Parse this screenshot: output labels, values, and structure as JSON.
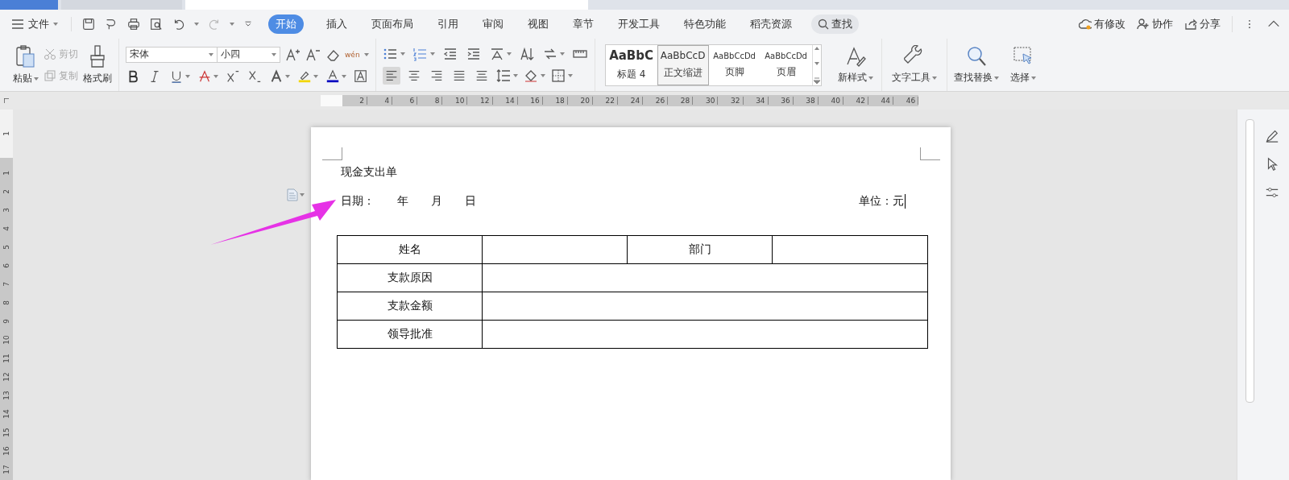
{
  "window_tabs": [
    {
      "kind": "home",
      "selected": false
    },
    {
      "kind": "template",
      "selected": false
    },
    {
      "kind": "document",
      "selected": true
    }
  ],
  "menu": {
    "file_label": "文件",
    "tabs": [
      {
        "label": "开始",
        "selected": true
      },
      {
        "label": "插入",
        "selected": false
      },
      {
        "label": "页面布局",
        "selected": false
      },
      {
        "label": "引用",
        "selected": false
      },
      {
        "label": "审阅",
        "selected": false
      },
      {
        "label": "视图",
        "selected": false
      },
      {
        "label": "章节",
        "selected": false
      },
      {
        "label": "开发工具",
        "selected": false
      },
      {
        "label": "特色功能",
        "selected": false
      },
      {
        "label": "稻壳资源",
        "selected": false
      }
    ],
    "search_label": "查找",
    "actions": [
      {
        "kind": "modified",
        "label": "有修改"
      },
      {
        "kind": "collaborate",
        "label": "协作"
      },
      {
        "kind": "share",
        "label": "分享"
      }
    ]
  },
  "toolbar": {
    "paste": "粘贴",
    "cut": {
      "label": "剪切",
      "disabled": true
    },
    "copy": {
      "label": "复制",
      "disabled": true
    },
    "format_painter": "格式刷",
    "font_name": "宋体",
    "font_size": "小四",
    "phonetic": "wén",
    "alignment": [
      {
        "kind": "left",
        "selected": true
      },
      {
        "kind": "center",
        "selected": false
      },
      {
        "kind": "right",
        "selected": false
      },
      {
        "kind": "justify",
        "selected": false
      },
      {
        "kind": "distributed",
        "selected": false
      }
    ],
    "styles": [
      {
        "kind": "heading",
        "preview": "AaBbC",
        "label": "标题 4",
        "selected": false
      },
      {
        "kind": "body",
        "preview": "AaBbCcD",
        "label": "正文缩进",
        "selected": true
      },
      {
        "kind": "small",
        "preview": "AaBbCcDd",
        "label": "页脚",
        "selected": false
      },
      {
        "kind": "small",
        "preview": "AaBbCcDd",
        "label": "页眉",
        "selected": false
      }
    ],
    "new_style": "新样式",
    "text_tools": "文字工具",
    "find_replace": "查找替换",
    "select": "选择"
  },
  "ruler": {
    "ticks": [
      "2",
      "4",
      "6",
      "8",
      "10",
      "12",
      "14",
      "16",
      "18",
      "20",
      "22",
      "24",
      "26",
      "28",
      "30",
      "32",
      "34",
      "36",
      "38",
      "40",
      "42",
      "44",
      "46"
    ]
  },
  "vertical_ruler": {
    "top_ticks": [
      "1"
    ],
    "ticks": [
      "1",
      "2",
      "3",
      "4",
      "5",
      "6",
      "7",
      "8",
      "9",
      "10",
      "11",
      "12",
      "13",
      "14",
      "15",
      "16",
      "17"
    ]
  },
  "document": {
    "title": "现金支出单",
    "date_parts": [
      "日期：",
      "年",
      "月",
      "日"
    ],
    "unit": "单位：元",
    "table": [
      {
        "kind": "split",
        "label": "姓名",
        "second_label": "部门"
      },
      {
        "kind": "wide",
        "label": "支款原因"
      },
      {
        "kind": "wide",
        "label": "支款金额"
      },
      {
        "kind": "wide",
        "label": "领导批准"
      }
    ]
  }
}
